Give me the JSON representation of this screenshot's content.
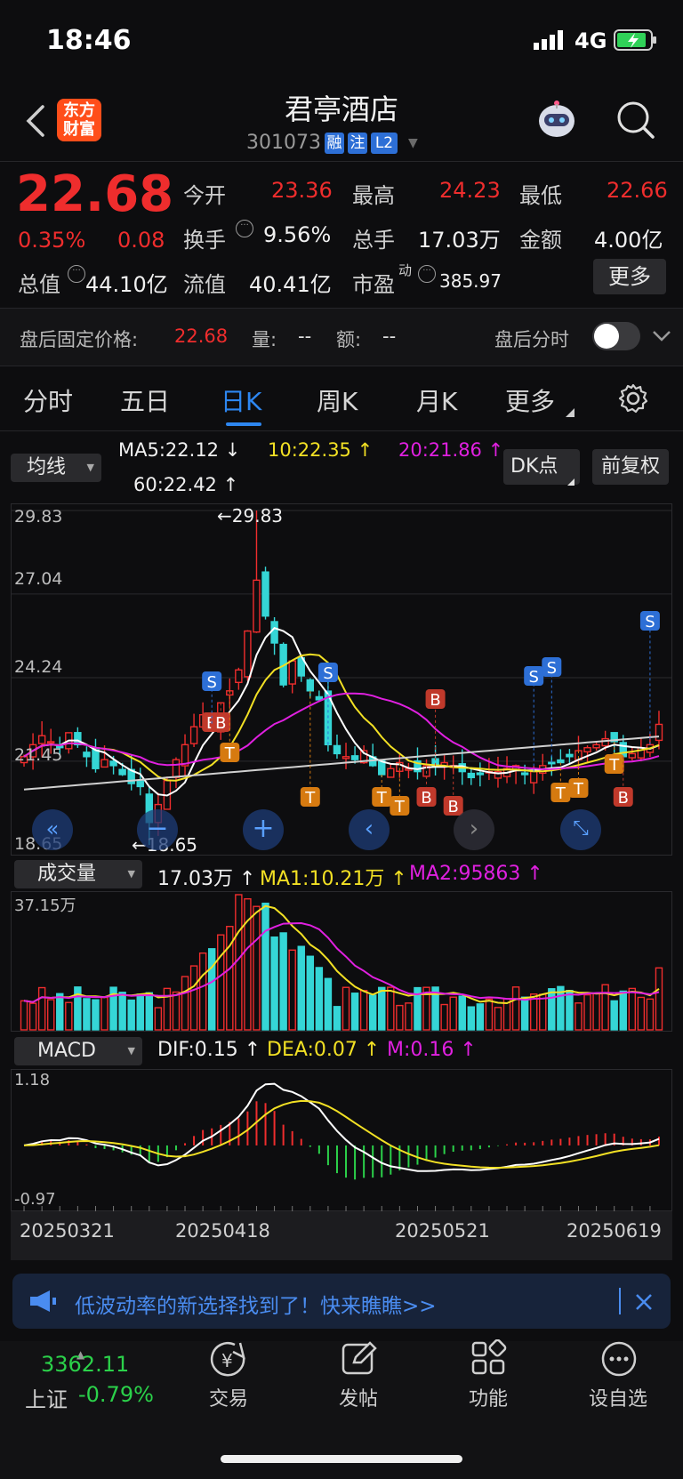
{
  "status_bar": {
    "time": "18:46",
    "network": "4G"
  },
  "header": {
    "title": "君亭酒店",
    "logo_line1": "东方",
    "logo_line2": "财富",
    "code": "301073",
    "tags": [
      "融",
      "注",
      "L2"
    ]
  },
  "quote": {
    "price": "22.68",
    "pct": "0.35%",
    "change": "0.08",
    "open_label": "今开",
    "open": "23.36",
    "high_label": "最高",
    "high": "24.23",
    "low_label": "最低",
    "low": "22.66",
    "turnover_label": "换手",
    "turnover": "9.56%",
    "vol_label": "总手",
    "vol": "17.03万",
    "amount_label": "金额",
    "amount": "4.00亿",
    "mcap_label": "总值",
    "mcap": "44.10亿",
    "float_label": "流值",
    "float": "40.41亿",
    "pe_label": "市盈",
    "pe_sup": "动",
    "pe": "385.97",
    "more": "更多"
  },
  "after_hours": {
    "label": "盘后固定价格:",
    "price": "22.68",
    "vol_label": "量:",
    "vol": "--",
    "amt_label": "额:",
    "amt": "--",
    "toggle_label": "盘后分时"
  },
  "tabs": [
    "分时",
    "五日",
    "日K",
    "周K",
    "月K",
    "更多"
  ],
  "active_tab": "日K",
  "ma_bar": {
    "selector": "均线",
    "ma5": "MA5:22.12",
    "ma10": "10:22.35",
    "ma20": "20:21.86",
    "ma60": "60:22.42",
    "dk": "DK点",
    "fq": "前复权"
  },
  "price_axis": {
    "labels": [
      "29.83",
      "27.04",
      "24.24",
      "21.45",
      "18.65"
    ],
    "high_mark": "29.83",
    "low_mark": "18.65"
  },
  "volume_bar": {
    "selector": "成交量",
    "vol": "17.03万",
    "ma1": "MA1:10.21万",
    "ma2": "MA2:95863",
    "axis_top": "37.15万"
  },
  "macd_bar": {
    "selector": "MACD",
    "dif": "DIF:0.15",
    "dea": "DEA:0.07",
    "m": "M:0.16",
    "axis_top": "1.18",
    "axis_bottom": "-0.97"
  },
  "dates": [
    "20250321",
    "20250418",
    "20250521",
    "20250619"
  ],
  "banner": {
    "text": "低波动率的新选择找到了！快来瞧瞧>>"
  },
  "bottom_nav": {
    "index_value": "3362.11",
    "index_name": "上证",
    "index_pct": "-0.79%",
    "items": [
      "交易",
      "发帖",
      "功能",
      "设自选"
    ]
  },
  "colors": {
    "up": "#ef2d2d",
    "down": "#35d6d6",
    "ma5": "#ffffff",
    "ma10": "#f2e024",
    "ma20": "#e020e0",
    "ma60": "#d0d0d0",
    "accent": "#2d86f0"
  },
  "chart_data": {
    "type": "candlestick",
    "price_ylim": [
      18.65,
      29.83
    ],
    "closes": [
      21.6,
      22.0,
      22.3,
      22.1,
      21.9,
      22.4,
      22.0,
      21.6,
      21.2,
      21.5,
      21.3,
      21.0,
      20.7,
      20.6,
      19.4,
      20.0,
      20.8,
      21.5,
      22.0,
      22.6,
      23.0,
      22.7,
      23.4,
      23.8,
      24.5,
      25.8,
      27.5,
      26.3,
      25.4,
      24.0,
      24.8,
      24.3,
      23.8,
      23.5,
      22.0,
      21.7,
      21.6,
      21.5,
      21.8,
      21.3,
      21.0,
      21.2,
      21.4,
      21.2,
      21.1,
      21.3,
      21.3,
      21.4,
      21.3,
      21.1,
      20.9,
      21.0,
      21.1,
      21.1,
      21.2,
      21.3,
      21.0,
      21.1,
      21.3,
      21.4,
      21.4,
      21.6,
      21.8,
      21.9,
      22.0,
      22.2,
      22.1,
      21.6,
      21.7,
      21.9,
      22.0,
      22.68
    ],
    "volume_ylim": [
      0,
      37.15
    ],
    "macd_ylim": [
      -0.97,
      1.18
    ]
  }
}
